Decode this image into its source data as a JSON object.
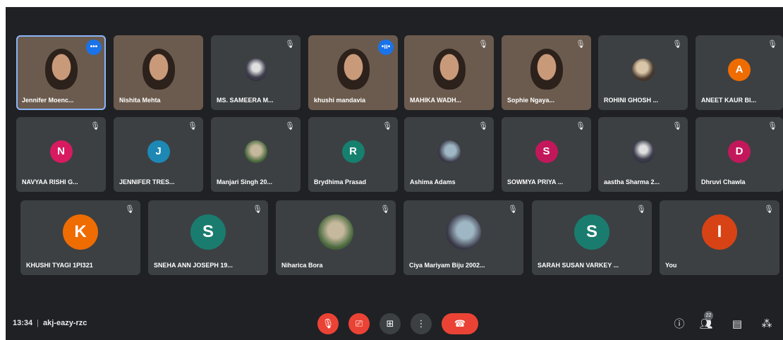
{
  "meeting": {
    "time": "13:34",
    "code": "akj-eazy-rzc"
  },
  "colors": {
    "background": "#202124",
    "tile": "#3c4043",
    "end_call": "#ea4335",
    "speaking": "#1a73e8",
    "avatar_N": "#d81b60",
    "avatar_J": "#1e88b5",
    "avatar_R": "#16806e",
    "avatar_S": "#c2185b",
    "avatar_D": "#c2185b",
    "avatar_A": "#ef6c00",
    "avatar_K": "#ef6c00",
    "avatar_S2": "#1a7c6e",
    "avatar_I": "#d84315"
  },
  "participants_row1": [
    {
      "name": "Jennifer Moenc...",
      "type": "video",
      "icon": "more-dots-icon"
    },
    {
      "name": "Nishita Mehta",
      "type": "video",
      "icon": "mic-off-icon"
    },
    {
      "name": "MS. SAMEERA M...",
      "type": "avatar-photo",
      "icon": "mic-off-icon"
    },
    {
      "name": "khushi mandavia",
      "type": "video",
      "icon": "speaking-icon"
    },
    {
      "name": "MAHIKA WADH...",
      "type": "video",
      "icon": "mic-off-icon"
    },
    {
      "name": "Sophie Ngaya...",
      "type": "video",
      "icon": "mic-off-icon"
    },
    {
      "name": "ROHINI GHOSH ...",
      "type": "avatar-photo",
      "icon": "mic-off-icon"
    },
    {
      "name": "ANEET KAUR BI...",
      "type": "avatar",
      "letter": "A",
      "icon": "mic-off-icon"
    }
  ],
  "participants_row2": [
    {
      "name": "NAVYAA RISHI G...",
      "letter": "N"
    },
    {
      "name": "JENNIFER TRES...",
      "letter": "J"
    },
    {
      "name": "Manjari Singh 20...",
      "letter": ""
    },
    {
      "name": "Brydhima Prasad",
      "letter": "R"
    },
    {
      "name": "Ashima Adams",
      "letter": ""
    },
    {
      "name": "SOWMYA PRIYA ...",
      "letter": "S"
    },
    {
      "name": "aastha Sharma 2...",
      "letter": ""
    },
    {
      "name": "Dhruvi Chawla",
      "letter": "D"
    }
  ],
  "participants_row3": [
    {
      "name": "KHUSHI TYAGI 1PI321",
      "letter": "K"
    },
    {
      "name": "SNEHA ANN JOSEPH 19...",
      "letter": "S"
    },
    {
      "name": "Niharica Bora",
      "letter": ""
    },
    {
      "name": "Ciya Mariyam Biju 2002...",
      "letter": ""
    },
    {
      "name": "SARAH SUSAN VARKEY ...",
      "letter": "S"
    },
    {
      "name": "You",
      "letter": "I"
    }
  ],
  "controls": {
    "mic": "mic-off-icon",
    "camera": "camera-off-icon",
    "present": "present-icon",
    "more": "more-vert-icon",
    "end": "end-call-icon"
  },
  "right_controls": {
    "people_count": "22"
  }
}
